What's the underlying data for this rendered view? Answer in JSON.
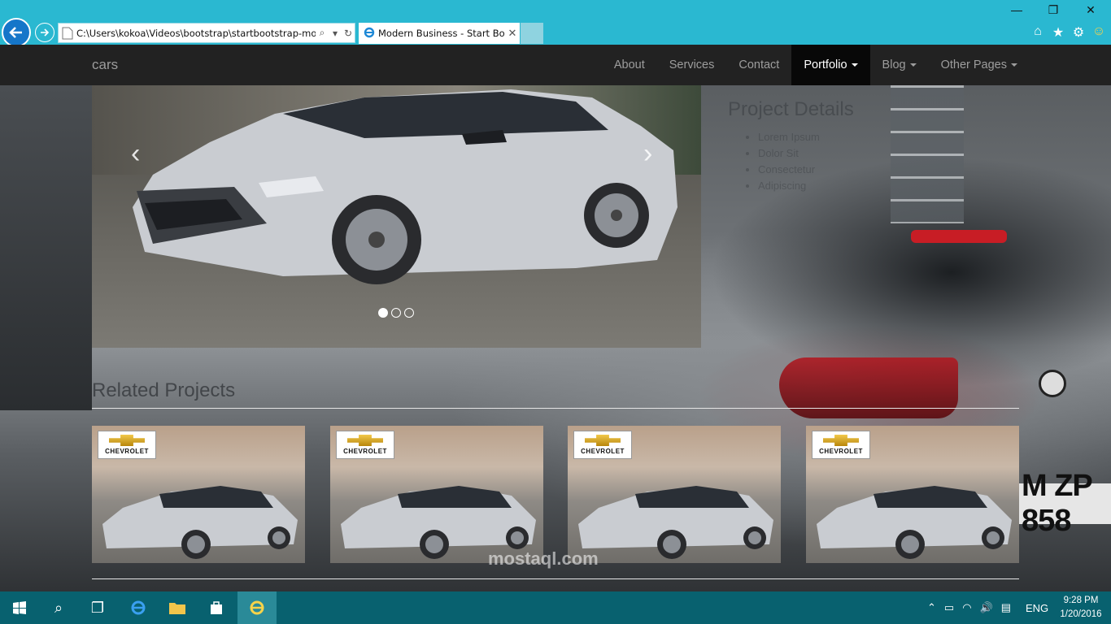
{
  "browser": {
    "address_url": "C:\\Users\\kokoa\\Videos\\bootstrap\\startbootstrap-mod",
    "tab_title": "Modern Business - Start Bo...",
    "icons": [
      "back-arrow-icon",
      "forward-arrow-icon",
      "search-icon",
      "refresh-icon",
      "home-icon",
      "star-icon",
      "gear-icon",
      "smiley-icon"
    ]
  },
  "navbar": {
    "brand": "cars",
    "items": [
      {
        "label": "About"
      },
      {
        "label": "Services"
      },
      {
        "label": "Contact"
      },
      {
        "label": "Portfolio",
        "active": true,
        "dropdown": true
      },
      {
        "label": "Blog",
        "dropdown": true
      },
      {
        "label": "Other Pages",
        "dropdown": true
      }
    ]
  },
  "carousel": {
    "slide_count": 3,
    "active_index": 0,
    "prev_icon": "chevron-left-icon",
    "next_icon": "chevron-right-icon"
  },
  "project_details": {
    "title": "Project Details",
    "items": [
      "Lorem Ipsum",
      "Dolor Sit",
      "Consectetur",
      "Adipiscing"
    ]
  },
  "related": {
    "title": "Related Projects",
    "thumbs": [
      {
        "brand": "CHEVROLET"
      },
      {
        "brand": "CHEVROLET"
      },
      {
        "brand": "CHEVROLET"
      },
      {
        "brand": "CHEVROLET"
      }
    ]
  },
  "background": {
    "plate_text": "M ZP 858"
  },
  "watermark": "mostaql.com",
  "taskbar": {
    "time": "9:28 PM",
    "date": "1/20/2016",
    "language": "ENG"
  },
  "colors": {
    "chrome": "#2ab8d1",
    "navbar": "#222222",
    "taskbar": "#08616f"
  }
}
